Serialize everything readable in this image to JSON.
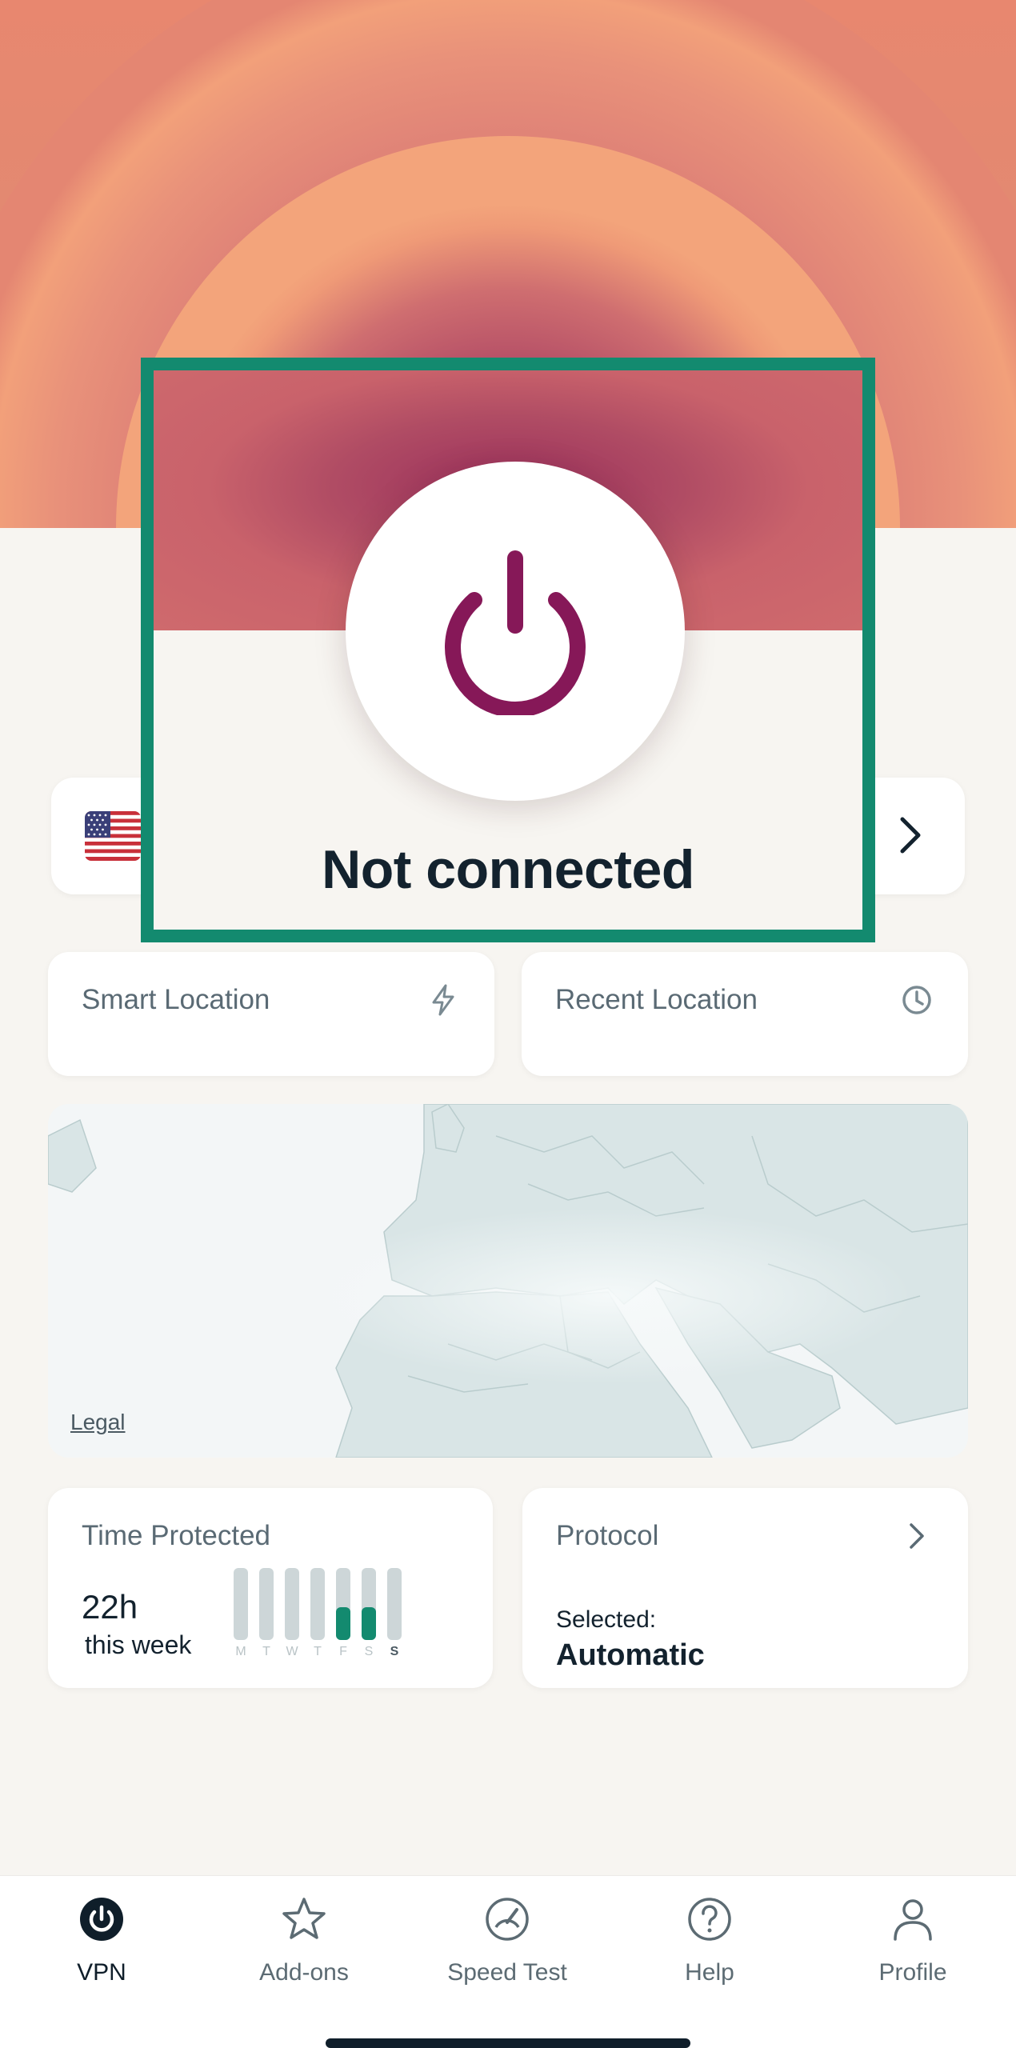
{
  "app": {
    "status_text": "Not connected",
    "accent_color": "#138a6f",
    "power_color": "#861858"
  },
  "location_card": {
    "flag_icon": "us-flag-icon",
    "chevron_icon": "chevron-right-icon"
  },
  "shortcuts": [
    {
      "label": "Smart Location",
      "icon": "lightning-icon"
    },
    {
      "label": "Recent Location",
      "icon": "clock-icon"
    }
  ],
  "map": {
    "legal_label": "Legal"
  },
  "time_protected": {
    "title": "Time Protected",
    "value": "22h",
    "caption": "this week",
    "days": [
      "M",
      "T",
      "W",
      "T",
      "F",
      "S",
      "S"
    ],
    "active_fraction": [
      0,
      0,
      0,
      0,
      0.45,
      0.45,
      0
    ]
  },
  "protocol": {
    "title": "Protocol",
    "selected_label": "Selected:",
    "value": "Automatic",
    "chevron_icon": "chevron-right-icon"
  },
  "nav": {
    "items": [
      {
        "label": "VPN",
        "icon": "power-icon",
        "active": true
      },
      {
        "label": "Add-ons",
        "icon": "star-icon",
        "active": false
      },
      {
        "label": "Speed Test",
        "icon": "speedometer-icon",
        "active": false
      },
      {
        "label": "Help",
        "icon": "help-icon",
        "active": false
      },
      {
        "label": "Profile",
        "icon": "profile-icon",
        "active": false
      }
    ]
  }
}
